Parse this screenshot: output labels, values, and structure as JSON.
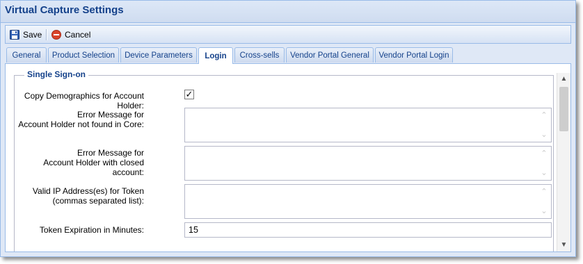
{
  "window": {
    "title": "Virtual Capture Settings"
  },
  "toolbar": {
    "save_label": "Save",
    "cancel_label": "Cancel",
    "save_icon": "floppy-disk-icon",
    "cancel_icon": "red-circle-cancel-icon"
  },
  "tabs": [
    {
      "label": "General"
    },
    {
      "label": "Product Selection"
    },
    {
      "label": "Device Parameters"
    },
    {
      "label": "Login"
    },
    {
      "label": "Cross-sells"
    },
    {
      "label": "Vendor Portal General"
    },
    {
      "label": "Vendor Portal Login"
    }
  ],
  "active_tab": "Login",
  "form": {
    "section_title": "Single Sign-on",
    "copy_demographics_label": "Copy Demographics for Account Holder:",
    "copy_demographics_checked": true,
    "not_found_label": "Error Message for\nAccount Holder not found in Core:",
    "not_found_value": "",
    "closed_account_label": "Error Message for\nAccount Holder with closed account:",
    "closed_account_value": "",
    "valid_ip_label": "Valid IP Address(es) for Token\n(commas separated list):",
    "valid_ip_value": "",
    "token_expiration_label": "Token Expiration in Minutes:",
    "token_expiration_value": "15"
  },
  "colors": {
    "accent": "#15428b",
    "border": "#99bbe8",
    "panel_bg": "#dfe8f6",
    "cancel_red": "#d9442b"
  }
}
